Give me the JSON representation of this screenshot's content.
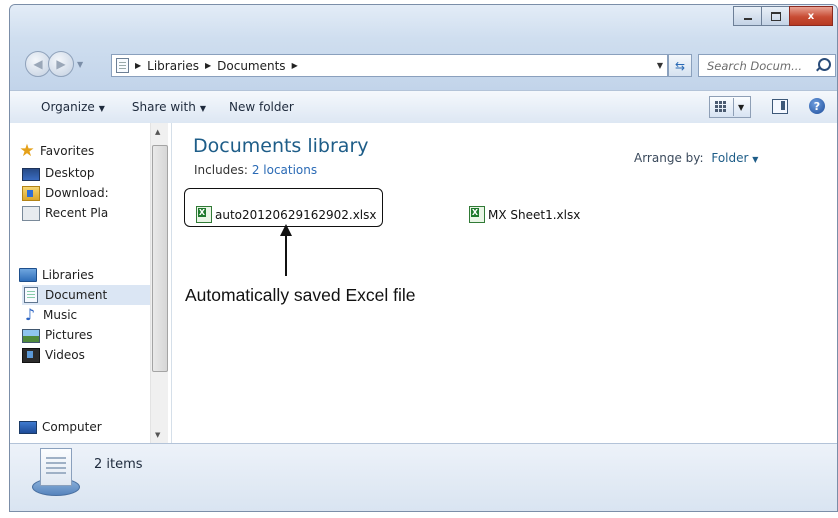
{
  "window": {
    "caption": {
      "minimize": "",
      "maximize": "",
      "close": "x"
    }
  },
  "address": {
    "crumbs": [
      "Libraries",
      "Documents"
    ],
    "search_placeholder": "Search Docum..."
  },
  "toolbar": {
    "organize": "Organize",
    "share_with": "Share with",
    "new_folder": "New folder"
  },
  "nav": {
    "favorites": "Favorites",
    "desktop": "Desktop",
    "downloads": "Download:",
    "recent": "Recent Pla",
    "libraries": "Libraries",
    "documents": "Document",
    "music": "Music",
    "pictures": "Pictures",
    "videos": "Videos",
    "computer": "Computer"
  },
  "main": {
    "title": "Documents library",
    "includes_label": "Includes:",
    "includes_link": "2 locations",
    "arrange_label": "Arrange by:",
    "arrange_value": "Folder",
    "files": [
      {
        "name": "auto20120629162902.xlsx"
      },
      {
        "name": "MX Sheet1.xlsx"
      }
    ]
  },
  "annotation": {
    "text": "Automatically saved Excel file"
  },
  "details": {
    "count": "2 items"
  }
}
